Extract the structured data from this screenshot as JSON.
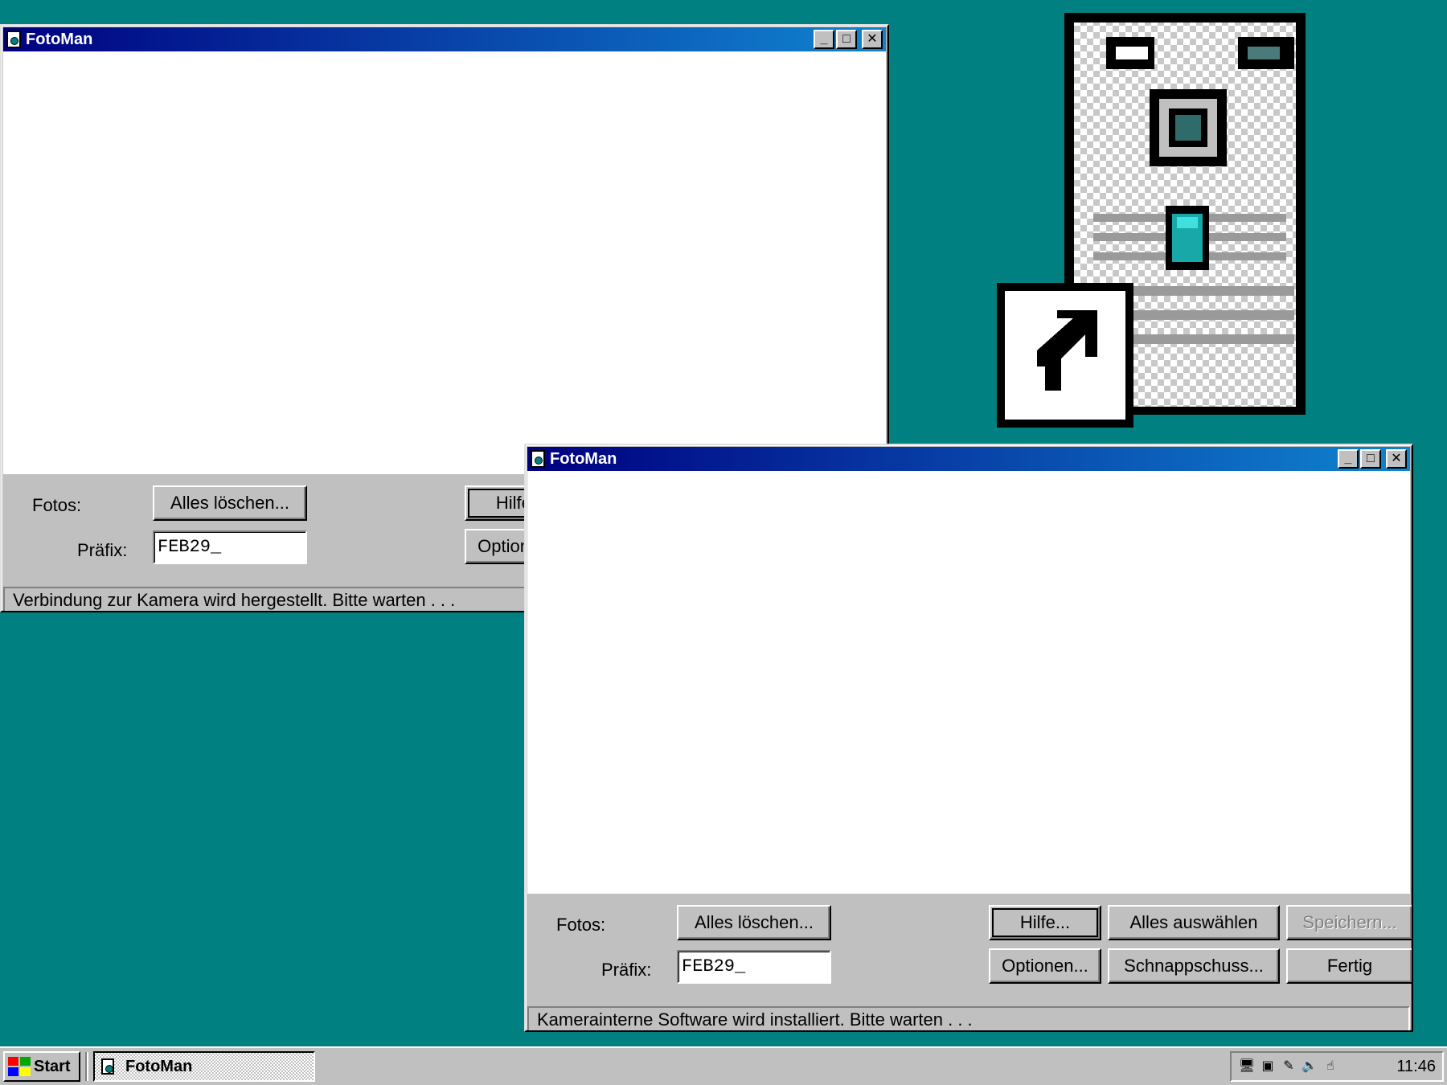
{
  "back_window": {
    "title": "FotoMan",
    "fotos_label": "Fotos:",
    "clear_all_label": "Alles löschen...",
    "help_label": "Hilfe...",
    "options_label": "Optionen...",
    "prefix_label": "Präfix:",
    "prefix_value": "FEB29_",
    "status": "Verbindung zur Kamera wird hergestellt. Bitte warten . . ."
  },
  "front_window": {
    "title": "FotoMan",
    "fotos_label": "Fotos:",
    "clear_all_label": "Alles löschen...",
    "help_label": "Hilfe...",
    "select_all_label": "Alles auswählen",
    "save_label": "Speichern...",
    "prefix_label": "Präfix:",
    "prefix_value": "FEB29_",
    "options_label": "Optionen...",
    "snapshot_label": "Schnappschuss...",
    "done_label": "Fertig",
    "status": "Kamerainterne Software wird installiert.  Bitte warten . . ."
  },
  "taskbar": {
    "start_label": "Start",
    "task_label": "FotoMan",
    "clock": "11:46"
  },
  "icons": {
    "desktop_shortcut": "fotoman-camera-shortcut-icon",
    "tray": [
      "monitor-icon",
      "network-icon",
      "pen-icon",
      "speaker-icon",
      "hand-icon"
    ]
  },
  "colors": {
    "desktop": "#008080",
    "titlebar_start": "#000080",
    "titlebar_end": "#1084d0",
    "face": "#c0c0c0"
  }
}
